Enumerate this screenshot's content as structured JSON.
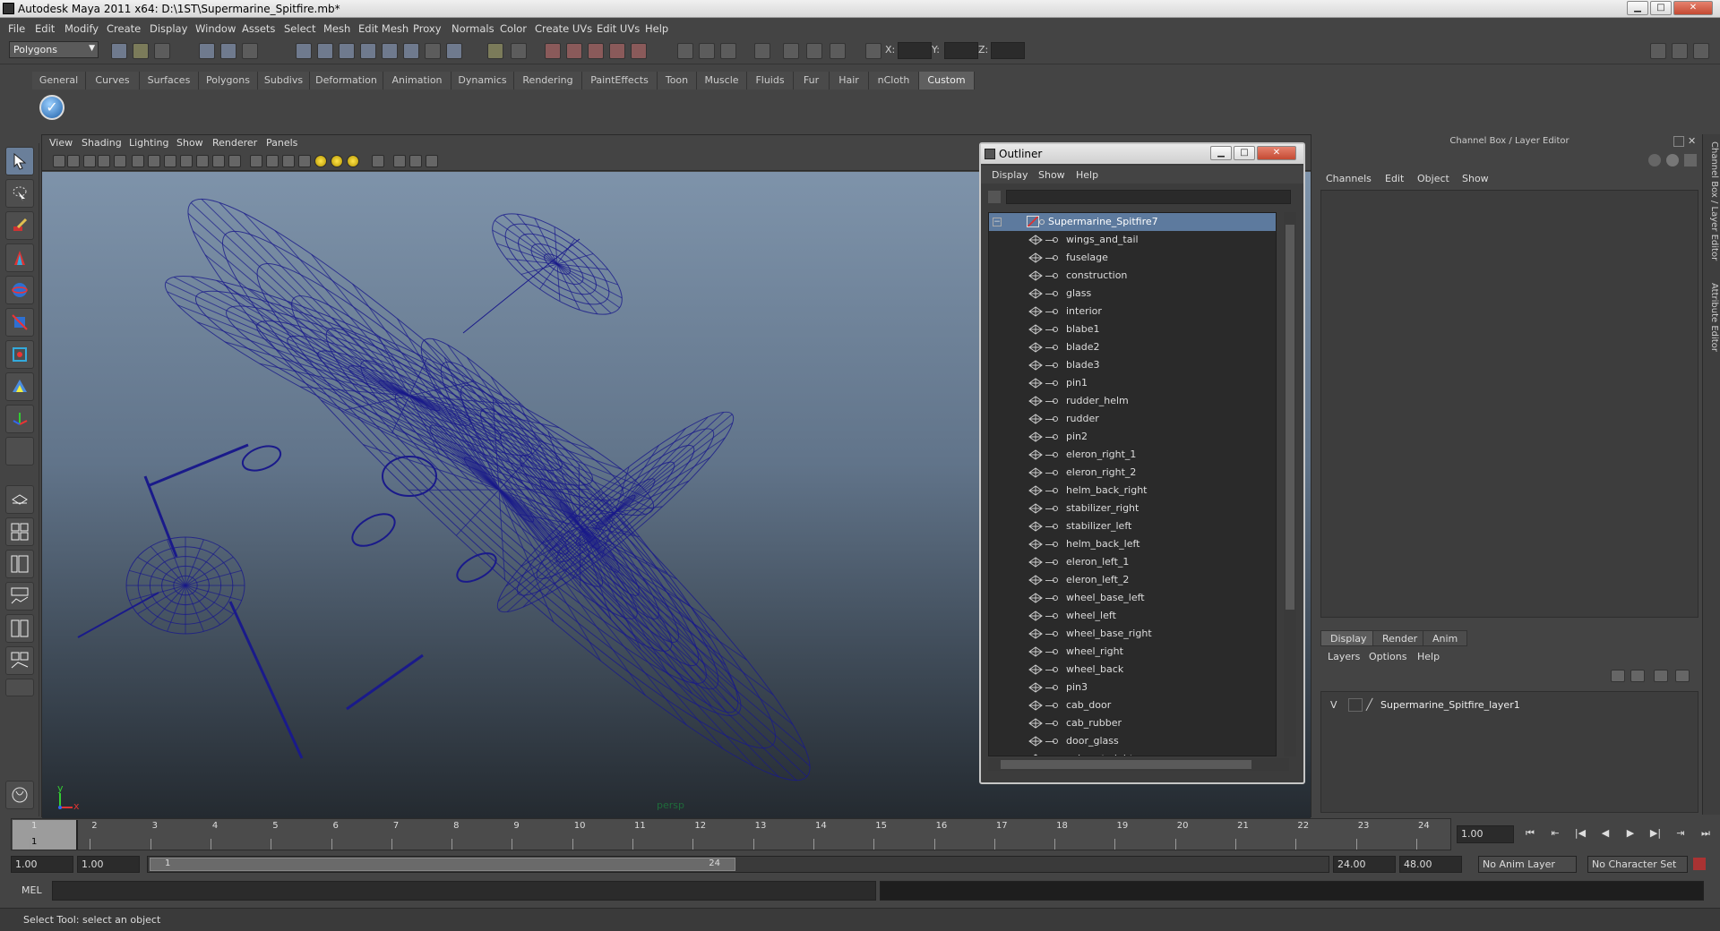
{
  "window": {
    "title": "Autodesk Maya 2011 x64: D:\\1ST\\Supermarine_Spitfire.mb*",
    "minimize": "▁",
    "maximize": "□",
    "close": "✕"
  },
  "menubar": [
    "File",
    "Edit",
    "Modify",
    "Create",
    "Display",
    "Window",
    "Assets",
    "Select",
    "Mesh",
    "Edit Mesh",
    "Proxy",
    "Normals",
    "Color",
    "Create UVs",
    "Edit UVs",
    "Help"
  ],
  "statusline": {
    "mode": "Polygons",
    "x_label": "X:",
    "y_label": "Y:",
    "z_label": "Z:"
  },
  "shelf": {
    "tabs": [
      "General",
      "Curves",
      "Surfaces",
      "Polygons",
      "Subdivs",
      "Deformation",
      "Animation",
      "Dynamics",
      "Rendering",
      "PaintEffects",
      "Toon",
      "Muscle",
      "Fluids",
      "Fur",
      "Hair",
      "nCloth",
      "Custom"
    ],
    "active": "Custom",
    "custom_button_glyph": "✓"
  },
  "viewport": {
    "menu": [
      "View",
      "Shading",
      "Lighting",
      "Show",
      "Renderer",
      "Panels"
    ],
    "camera_label": "persp",
    "axis_x": "x",
    "axis_y": "y",
    "wire_color": "#1a1a8a"
  },
  "outliner": {
    "title": "Outliner",
    "menu": [
      "Display",
      "Show",
      "Help"
    ],
    "root": "Supermarine_Spitfire7",
    "items": [
      "wings_and_tail",
      "fuselage",
      "construction",
      "glass",
      "interior",
      "blabe1",
      "blade2",
      "blade3",
      "pin1",
      "rudder_helm",
      "rudder",
      "pin2",
      "eleron_right_1",
      "eleron_right_2",
      "helm_back_right",
      "stabilizer_right",
      "stabilizer_left",
      "helm_back_left",
      "eleron_left_1",
      "eleron_left_2",
      "wheel_base_left",
      "wheel_left",
      "wheel_base_right",
      "wheel_right",
      "wheel_back",
      "pin3",
      "cab_door",
      "cab_rubber",
      "door_glass",
      "exhaust_right"
    ]
  },
  "channel_box": {
    "title": "Channel Box / Layer Editor",
    "menu": [
      "Channels",
      "Edit",
      "Object",
      "Show"
    ],
    "layer_tabs": [
      "Display",
      "Render",
      "Anim"
    ],
    "layer_menu": [
      "Layers",
      "Options",
      "Help"
    ],
    "layer": {
      "visibility": "V",
      "name": "Supermarine_Spitfire_layer1"
    }
  },
  "side_tabs": [
    "Channel Box / Layer Editor",
    "Attribute Editor"
  ],
  "timeslider": {
    "frames": [
      "1",
      "2",
      "3",
      "4",
      "5",
      "6",
      "7",
      "8",
      "9",
      "10",
      "11",
      "12",
      "13",
      "14",
      "15",
      "16",
      "17",
      "18",
      "19",
      "20",
      "21",
      "22",
      "23",
      "24"
    ],
    "current_frame_label": "1",
    "current_time": "1.00"
  },
  "playback": [
    "⏮",
    "⇤",
    "|◀",
    "◀",
    "▶",
    "▶|",
    "⇥",
    "⏭"
  ],
  "range": {
    "start_time": "1.00",
    "playback_start": "1.00",
    "range_start_label": "1",
    "range_end_label": "24",
    "playback_end": "24.00",
    "end_time": "48.00",
    "anim_layer": "No Anim Layer",
    "character_set": "No Character Set"
  },
  "cmdline": {
    "label": "MEL"
  },
  "helpline": {
    "text": "Select Tool: select an object"
  }
}
